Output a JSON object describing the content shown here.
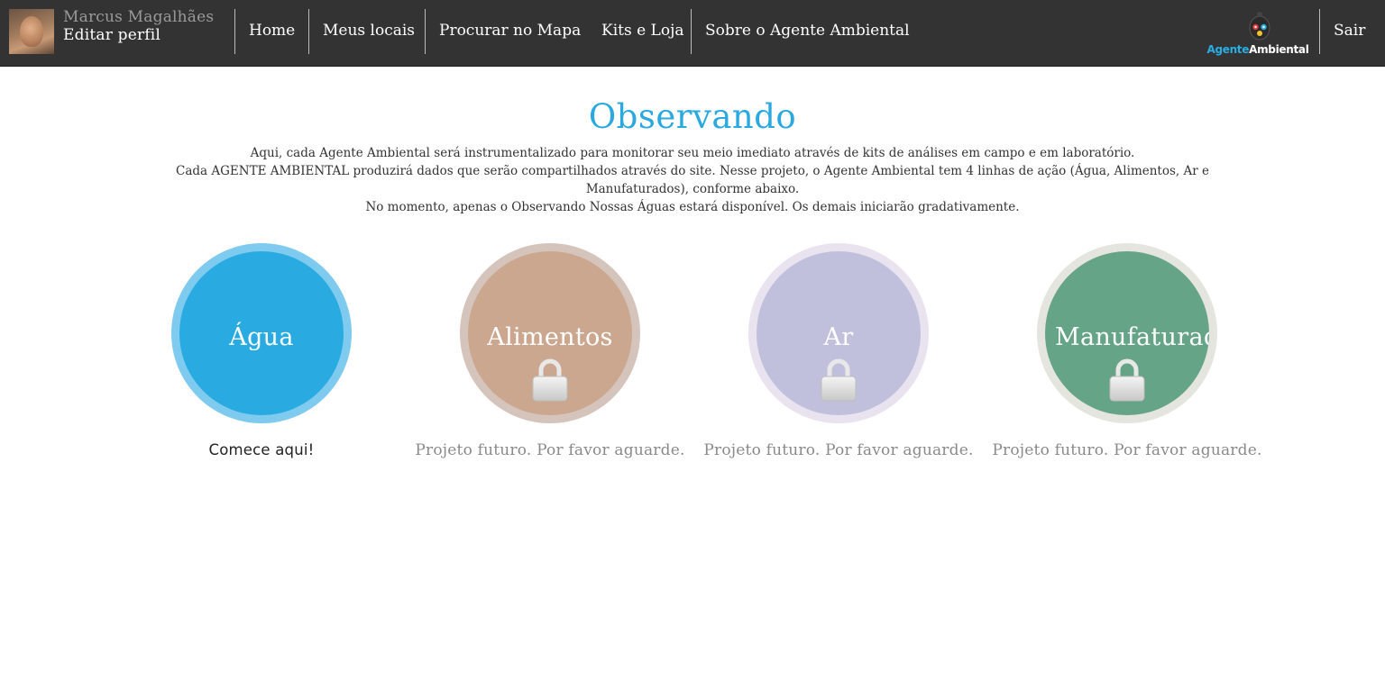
{
  "header": {
    "user_name": "Marcus Magalhães",
    "edit_profile": "Editar perfil",
    "nav": [
      {
        "label": "Home"
      },
      {
        "label": "Meus locais"
      },
      {
        "label": "Procurar no Mapa"
      },
      {
        "label": "Kits e Loja"
      },
      {
        "label": "Sobre o Agente Ambiental"
      }
    ],
    "logo": {
      "part1": "Agente",
      "part2": "Ambiental"
    },
    "logout": "Sair"
  },
  "main": {
    "title": "Observando",
    "intro": [
      "Aqui, cada Agente Ambiental será instrumentalizado para monitorar seu meio imediato através de kits de análises em campo e em laboratório.",
      "Cada AGENTE AMBIENTAL produzirá dados que serão compartilhados através do site. Nesse projeto, o Agente Ambiental tem 4 linhas de ação (Água, Alimentos, Ar e Manufaturados), conforme abaixo.",
      "No momento, apenas o Observando Nossas Águas estará disponível. Os demais iniciarão gradativamente."
    ],
    "cards": [
      {
        "label": "Água",
        "caption": "Comece aqui!",
        "locked": false,
        "ring_color": "#7ecbef",
        "disc_color": "#29abe2"
      },
      {
        "label": "Alimentos",
        "caption": "Projeto futuro. Por favor aguarde.",
        "locked": true,
        "ring_color": "#d5c4bb",
        "disc_color": "#cca78f"
      },
      {
        "label": "Ar",
        "caption": "Projeto futuro. Por favor aguarde.",
        "locked": true,
        "ring_color": "#e9e3ef",
        "disc_color": "#c0c0dd"
      },
      {
        "label": "Manufaturados",
        "caption": "Projeto futuro. Por favor aguarde.",
        "locked": true,
        "ring_color": "#e5e5df",
        "disc_color": "#66a487"
      }
    ]
  }
}
